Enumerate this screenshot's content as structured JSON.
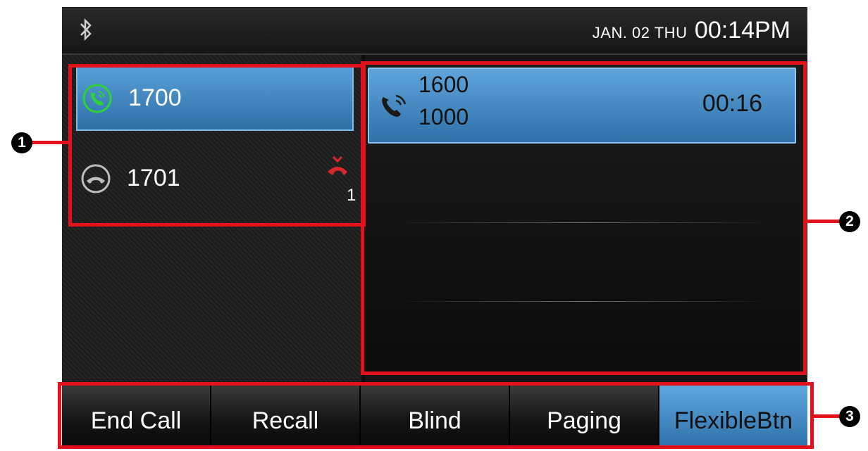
{
  "status_bar": {
    "bluetooth_icon": "bluetooth-icon",
    "date": "JAN. 02 THU",
    "time": "00:14PM"
  },
  "lines": [
    {
      "label": "1700",
      "icon": "active-call-icon",
      "state": "active"
    },
    {
      "label": "1701",
      "icon": "idle-line-icon",
      "state": "idle",
      "missed_icon": "missed-call-icon",
      "missed_count": "1"
    }
  ],
  "call": {
    "icon": "call-in-progress-icon",
    "number_primary": "1600",
    "number_secondary": "1000",
    "duration": "00:16"
  },
  "softkeys": [
    {
      "label": "End Call",
      "active": false
    },
    {
      "label": "Recall",
      "active": false
    },
    {
      "label": "Blind",
      "active": false
    },
    {
      "label": "Paging",
      "active": false
    },
    {
      "label": "FlexibleBtn",
      "active": true
    }
  ],
  "callouts": [
    "1",
    "2",
    "3"
  ],
  "colors": {
    "accent_blue": "#3f86c4",
    "highlight_red": "#e3111b",
    "active_call_green": "#2fd13a",
    "missed_red": "#d8262d"
  }
}
